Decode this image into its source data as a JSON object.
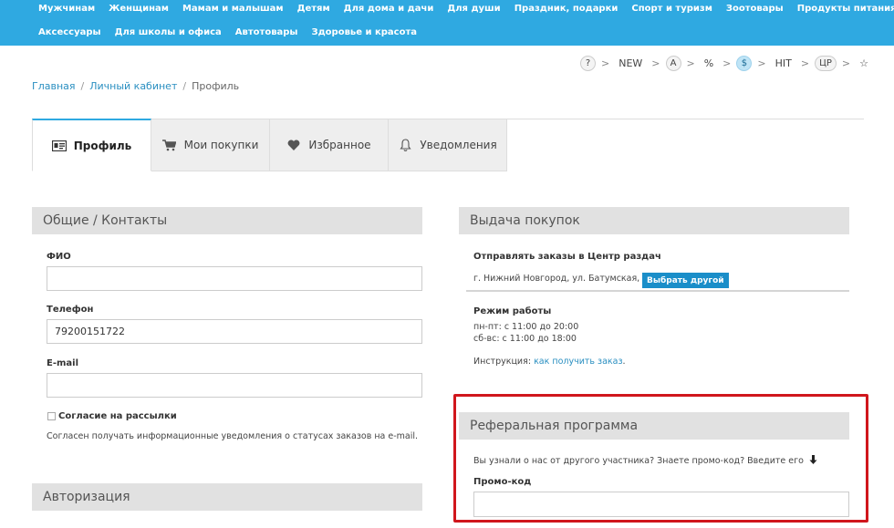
{
  "nav": {
    "row1": [
      "Мужчинам",
      "Женщинам",
      "Мамам и малышам",
      "Детям",
      "Для дома и дачи",
      "Для души",
      "Праздник, подарки",
      "Спорт и туризм",
      "Зоотовары",
      "Продукты питания"
    ],
    "row2": [
      "Аксессуары",
      "Для школы и офиса",
      "Автотовары",
      "Здоровье и красота"
    ]
  },
  "chips": [
    "?",
    "NEW",
    "A",
    "%",
    "$",
    "HIT",
    "ЦР",
    "☆"
  ],
  "chip_sep": ">",
  "breadcrumb": {
    "home": "Главная",
    "cabinet": "Личный кабинет",
    "current": "Профиль",
    "sep": "/"
  },
  "tabs": [
    {
      "label": "Профиль",
      "icon": "id-card-icon"
    },
    {
      "label": "Мои покупки",
      "icon": "cart-icon"
    },
    {
      "label": "Избранное",
      "icon": "heart-icon"
    },
    {
      "label": "Уведомления",
      "icon": "bell-icon"
    }
  ],
  "contacts": {
    "title": "Общие / Контакты",
    "fio_label": "ФИО",
    "fio_value": "",
    "phone_label": "Телефон",
    "phone_value": "79200151722",
    "email_label": "E-mail",
    "email_value": "",
    "consent_label": "Согласие на рассылки",
    "consent_text": "Согласен получать информационные уведомления о статусах заказов на e-mail."
  },
  "auth": {
    "title": "Авторизация"
  },
  "pickup": {
    "title": "Выдача покупок",
    "send_label": "Отправлять заказы в Центр раздач",
    "address": "г. Нижний Новгород, ул. Батумская, 5Б",
    "choose_button": "Выбрать другой",
    "hours_label": "Режим работы",
    "hours_weekdays": "пн-пт: с 11:00 до 20:00",
    "hours_weekend": "сб-вс: с 11:00 до 18:00",
    "instruction_prefix": "Инструкция:",
    "instruction_link": "как получить заказ",
    "instruction_suffix": "."
  },
  "referral": {
    "title": "Реферальная программа",
    "question": "Вы узнали о нас от другого участника? Знаете промо-код? Введите его",
    "promo_label": "Промо-код",
    "promo_value": ""
  },
  "colors": {
    "nav": "#2fa9e1",
    "link": "#2a8fc1",
    "button": "#1a8ec9",
    "highlight": "#d0161c",
    "panel_header": "#e1e1e1"
  }
}
